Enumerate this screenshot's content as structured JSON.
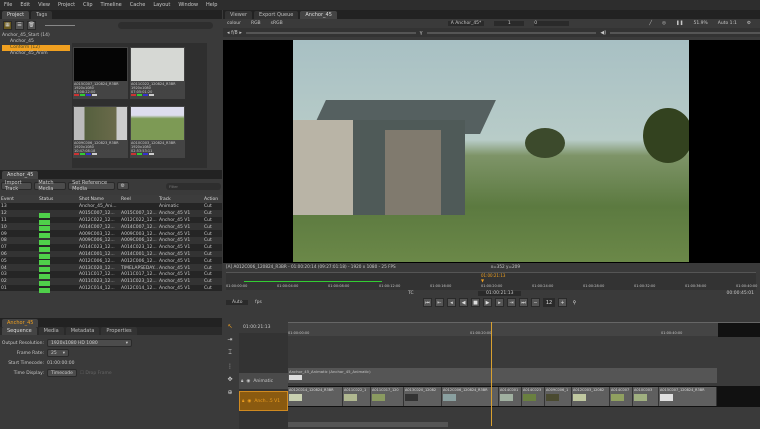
{
  "menu": [
    "File",
    "Edit",
    "View",
    "Project",
    "Clip",
    "Timeline",
    "Cache",
    "Layout",
    "Window",
    "Help"
  ],
  "project_panel": {
    "tabs": [
      "Project",
      "Tags"
    ],
    "tree": [
      {
        "label": "Anchor_45_Start (14)"
      },
      {
        "label": "Anchor_45"
      },
      {
        "label": "Conform (12)",
        "selected": true
      },
      {
        "label": "Anchor_45_Anim"
      }
    ],
    "thumbnails": [
      {
        "name": "A015C007_120824_R3BR",
        "res": "1920x1080",
        "fps": "11M @25FPS",
        "tc": "07:08:22:00",
        "color": "#050505"
      },
      {
        "name": "A011C022_120824_R3BR",
        "res": "1920x1080",
        "fps": "11M @25FPS",
        "tc": "07:05:01:20",
        "color": "#d6d8d4"
      },
      {
        "name": "A009C006_120823_R3BR",
        "res": "1920x1080",
        "fps": "11M @25FPS",
        "tc": "10:47:08:18",
        "color": "#8f9170"
      },
      {
        "name": "A010C003_120824_R3BR",
        "res": "1920x1080",
        "fps": "11M @25FPS",
        "tc": "02:53:53:11",
        "color": "#7d9a55"
      }
    ]
  },
  "conform_panel": {
    "tab": "Anchor_45",
    "buttons": [
      "Import Track",
      "Match Media",
      "Set Reference Media"
    ],
    "filter_placeholder": "Filter",
    "columns": [
      "Event",
      "Status",
      "Shot Name",
      "Reel",
      "Track",
      "Action"
    ],
    "rows": [
      [
        "13",
        "",
        "Anchor_45_Ani...",
        "",
        "Animatic",
        "Cut"
      ],
      [
        "12",
        "OK",
        "A015C007_12...",
        "A015C007_12...",
        "Anchor_45 V1",
        "Cut"
      ],
      [
        "11",
        "OK",
        "A012C022_12...",
        "A012C022_12...",
        "Anchor_45 V1",
        "Cut"
      ],
      [
        "10",
        "OK",
        "A014C007_12...",
        "A014C007_12...",
        "Anchor_45 V1",
        "Cut"
      ],
      [
        "09",
        "OK",
        "A009C003_12...",
        "A009C003_12...",
        "Anchor_45 V1",
        "Cut"
      ],
      [
        "08",
        "OK",
        "A009C006_12...",
        "A009C006_12...",
        "Anchor_45 V1",
        "Cut"
      ],
      [
        "07",
        "OK",
        "A014C023_12...",
        "A014C023_12...",
        "Anchor_45 V1",
        "Cut"
      ],
      [
        "06",
        "OK",
        "A014C001_12...",
        "A014C001_12...",
        "Anchor_45 V1",
        "Cut"
      ],
      [
        "05",
        "OK",
        "A012C006_12...",
        "A012C006_12...",
        "Anchor_45 V1",
        "Cut"
      ],
      [
        "04",
        "OK",
        "A013C020_12...",
        "TIMELAPSEDAY...",
        "Anchor_45 V1",
        "Cut"
      ],
      [
        "03",
        "OK",
        "A011C017_12...",
        "A011C017_12...",
        "Anchor_45 V1",
        "Cut"
      ],
      [
        "02",
        "OK",
        "A011C023_12...",
        "A011C023_12...",
        "Anchor_45 V1",
        "Cut"
      ],
      [
        "01",
        "OK",
        "A012C014_12...",
        "A012C014_12...",
        "Anchor_45 V1",
        "Cut"
      ]
    ]
  },
  "viewer": {
    "tabs": [
      "Viewer",
      "Export Queue",
      "Anchor_45"
    ],
    "channels": "colour",
    "rgb": "RGB",
    "lut": "sRGB",
    "input_a": "Anchor_45*",
    "frame": "1",
    "gain": "0",
    "zoom": "51.9%",
    "scale": "Auto 1:1",
    "info": "[A] A012C006_120824_R3BR - 01:00:20:14 (09:27:01:18) - 1920 x 1080 - 25 FPS",
    "coords": "x=352 y=209",
    "ruler_ticks": [
      "01:00:00:00",
      "01:00:04:00",
      "01:00:08:00",
      "01:00:12:00",
      "01:00:16:00",
      "01:00:20:00",
      "01:00:24:00",
      "01:00:28:00",
      "01:00:32:00",
      "01:00:36:00",
      "01:00:40:00"
    ],
    "playhead": "01:00:21:13",
    "tc_mode": "TC",
    "current_tc": "01:00:21:13",
    "end_tc": "00:00:45:01",
    "fps_mode": "Auto",
    "fps_label": "fps",
    "step": "12",
    "cache_progress": 0.27
  },
  "sequence_panel": {
    "tab": "Anchor_45",
    "subtabs": [
      "Sequence",
      "Media",
      "Metadata",
      "Properties"
    ],
    "output_resolution_label": "Output Resolution:",
    "output_resolution": "1920x1080 HD 1080",
    "frame_rate_label": "Frame Rate:",
    "frame_rate": "25",
    "start_tc_label": "Start Timecode:",
    "start_tc": "01:00:00:00",
    "time_display_label": "Time Display:",
    "time_display": "Timecode",
    "drop_frame": "Drop Frame"
  },
  "timeline": {
    "timecode": "01:00:21:13",
    "ruler": [
      "01:00:00:00",
      "01:00:20:00",
      "01:00:40:00"
    ],
    "tracks": [
      {
        "name": "Animatic"
      },
      {
        "name": "Anch...5 V1"
      }
    ],
    "animatic_clip": "Anchor_45_Animatic (Anchor_45_Animatic)",
    "clips": [
      "A012C014_120824_R3BR",
      "A011C022_1",
      "A011C017_120",
      "A013C020_12082",
      "A012C006_120824_R3BR",
      "A014C001",
      "A014C023",
      "A009C006_1",
      "A012C003_12082",
      "A014C007",
      "A010C003",
      "A015C007_120824_R3BR"
    ]
  },
  "colors": {
    "accent": "#f0a020",
    "status_ok": "#4fd04a",
    "selected_track": "#8a5a10"
  }
}
